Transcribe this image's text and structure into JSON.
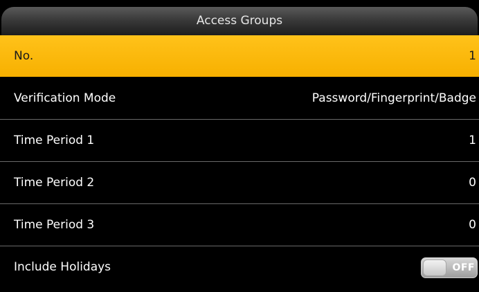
{
  "header": {
    "title": "Access Groups"
  },
  "colors": {
    "selected_row": "#f7b000",
    "background": "#000000",
    "text": "#ffffff"
  },
  "rows": [
    {
      "label": "No.",
      "value": "1",
      "selected": true
    },
    {
      "label": "Verification Mode",
      "value": "Password/Fingerprint/Badge"
    },
    {
      "label": "Time Period 1",
      "value": "1"
    },
    {
      "label": "Time Period 2",
      "value": "0"
    },
    {
      "label": "Time Period 3",
      "value": "0"
    },
    {
      "label": "Include Holidays",
      "toggle": {
        "state": "OFF"
      }
    }
  ]
}
